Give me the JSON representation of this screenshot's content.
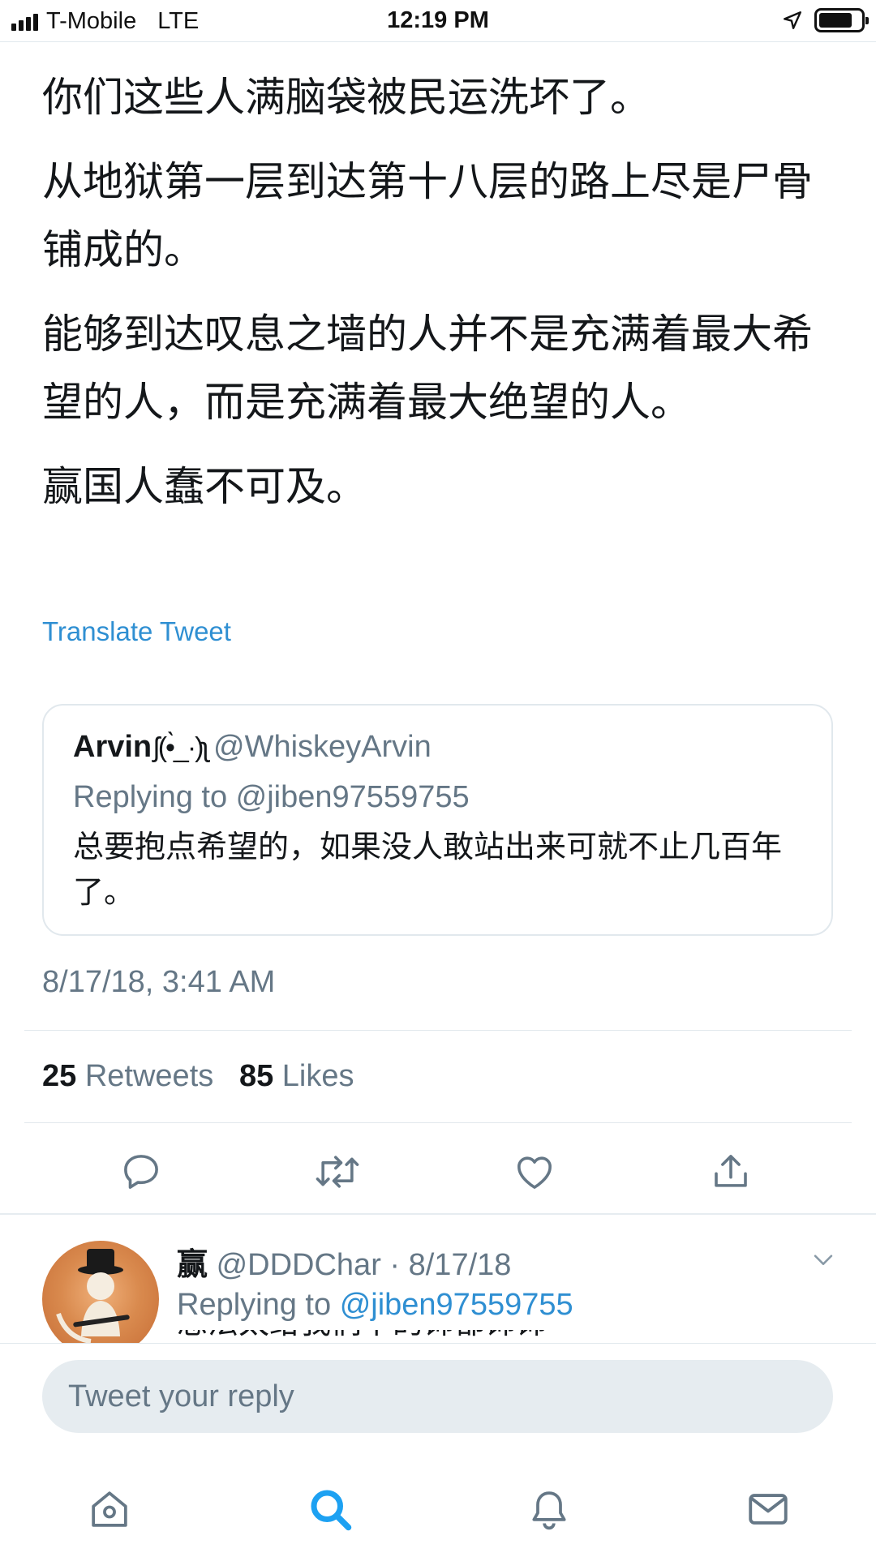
{
  "status_bar": {
    "carrier": "T-Mobile",
    "network": "LTE",
    "time": "12:19 PM",
    "battery_level": 0.8
  },
  "tweet": {
    "paragraphs": [
      "你们这些人满脑袋被民运洗坏了。",
      "从地狱第一层到达第十八层的路上尽是尸骨铺成的。",
      "能够到达叹息之墙的人并不是充满着最大希望的人，而是充满着最大绝望的人。",
      "赢国人蠢不可及。"
    ],
    "translate_label": "Translate Tweet",
    "timestamp": "8/17/18, 3:41 AM"
  },
  "quoted_tweet": {
    "name": "Arvin",
    "emoji": "ʃ(•̀_·)ʅ",
    "handle": "@WhiskeyArvin",
    "replying_to": "Replying to @jiben97559755",
    "text": "总要抱点希望的，如果没人敢站出来可就不止几百年了。"
  },
  "stats": {
    "retweets_count": "25",
    "retweets_label": "Retweets",
    "likes_count": "85",
    "likes_label": "Likes"
  },
  "actions": [
    {
      "icon": "reply-icon"
    },
    {
      "icon": "retweet-icon"
    },
    {
      "icon": "like-icon"
    },
    {
      "icon": "share-icon"
    }
  ],
  "reply": {
    "name": "赢",
    "handle_date": "@DDDChar · 8/17/18",
    "replying_prefix": "Replying to",
    "replying_handle": "@jiben97559755",
    "text_fragment": "想法太给我们下的饰都饰饰"
  },
  "compose": {
    "placeholder": "Tweet your reply"
  },
  "tab_bar": {
    "tabs": [
      {
        "icon": "home-icon",
        "active": false
      },
      {
        "icon": "search-icon",
        "active": true
      },
      {
        "icon": "notifications-icon",
        "active": false
      },
      {
        "icon": "messages-icon",
        "active": false
      }
    ],
    "active_color": "#1da1f2",
    "inactive_color": "#657786"
  }
}
